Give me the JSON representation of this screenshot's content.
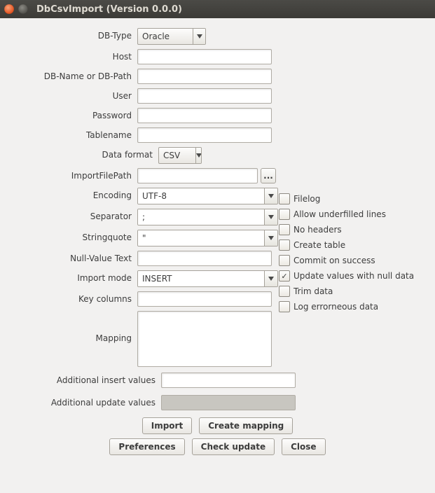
{
  "window": {
    "title": "DbCsvImport (Version 0.0.0)"
  },
  "labels": {
    "db_type": "DB-Type",
    "host": "Host",
    "db_name": "DB-Name or DB-Path",
    "user": "User",
    "password": "Password",
    "tablename": "Tablename",
    "data_format": "Data format",
    "import_path": "ImportFilePath",
    "encoding": "Encoding",
    "separator": "Separator",
    "stringquote": "Stringquote",
    "null_value": "Null-Value Text",
    "import_mode": "Import mode",
    "key_columns": "Key columns",
    "mapping": "Mapping",
    "add_insert": "Additional insert values",
    "add_update": "Additional update values"
  },
  "values": {
    "db_type": "Oracle",
    "host": "",
    "db_name": "",
    "user": "",
    "password": "",
    "tablename": "",
    "data_format": "CSV",
    "import_path": "",
    "encoding": "UTF-8",
    "separator": ";",
    "stringquote": "\"",
    "null_value": "",
    "import_mode": "INSERT",
    "key_columns": "",
    "mapping": "",
    "add_insert": "",
    "add_update": ""
  },
  "browse_button": "...",
  "checks": {
    "filelog": {
      "label": "Filelog",
      "checked": false
    },
    "underfilled": {
      "label": "Allow underfilled lines",
      "checked": false
    },
    "no_headers": {
      "label": "No headers",
      "checked": false
    },
    "create_table": {
      "label": "Create table",
      "checked": false
    },
    "commit_success": {
      "label": "Commit on success",
      "checked": false
    },
    "update_null": {
      "label": "Update values with null data",
      "checked": true
    },
    "trim_data": {
      "label": "Trim data",
      "checked": false
    },
    "log_err": {
      "label": "Log errorneous data",
      "checked": false
    }
  },
  "buttons": {
    "import": "Import",
    "create_mapping": "Create mapping",
    "preferences": "Preferences",
    "check_update": "Check update",
    "close": "Close"
  }
}
